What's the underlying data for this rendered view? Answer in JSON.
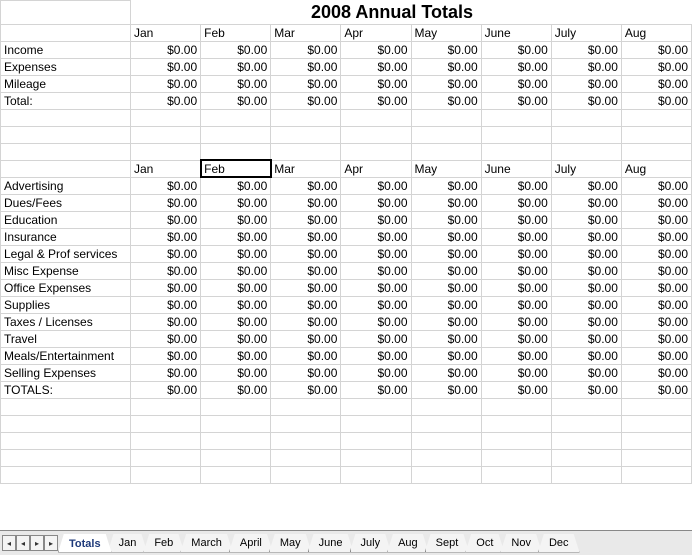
{
  "title": "2008 Annual Totals",
  "months": [
    "Jan",
    "Feb",
    "Mar",
    "Apr",
    "May",
    "June",
    "July",
    "Aug"
  ],
  "summary_rows": [
    {
      "label": "Income",
      "vals": [
        "$0.00",
        "$0.00",
        "$0.00",
        "$0.00",
        "$0.00",
        "$0.00",
        "$0.00",
        "$0.00"
      ]
    },
    {
      "label": "Expenses",
      "vals": [
        "$0.00",
        "$0.00",
        "$0.00",
        "$0.00",
        "$0.00",
        "$0.00",
        "$0.00",
        "$0.00"
      ]
    },
    {
      "label": "Mileage",
      "vals": [
        "$0.00",
        "$0.00",
        "$0.00",
        "$0.00",
        "$0.00",
        "$0.00",
        "$0.00",
        "$0.00"
      ]
    },
    {
      "label": "Total:",
      "vals": [
        "$0.00",
        "$0.00",
        "$0.00",
        "$0.00",
        "$0.00",
        "$0.00",
        "$0.00",
        "$0.00"
      ]
    }
  ],
  "detail_rows": [
    {
      "label": "Advertising",
      "vals": [
        "$0.00",
        "$0.00",
        "$0.00",
        "$0.00",
        "$0.00",
        "$0.00",
        "$0.00",
        "$0.00"
      ]
    },
    {
      "label": "Dues/Fees",
      "vals": [
        "$0.00",
        "$0.00",
        "$0.00",
        "$0.00",
        "$0.00",
        "$0.00",
        "$0.00",
        "$0.00"
      ]
    },
    {
      "label": "Education",
      "vals": [
        "$0.00",
        "$0.00",
        "$0.00",
        "$0.00",
        "$0.00",
        "$0.00",
        "$0.00",
        "$0.00"
      ]
    },
    {
      "label": "Insurance",
      "vals": [
        "$0.00",
        "$0.00",
        "$0.00",
        "$0.00",
        "$0.00",
        "$0.00",
        "$0.00",
        "$0.00"
      ]
    },
    {
      "label": "Legal & Prof services",
      "vals": [
        "$0.00",
        "$0.00",
        "$0.00",
        "$0.00",
        "$0.00",
        "$0.00",
        "$0.00",
        "$0.00"
      ]
    },
    {
      "label": "Misc Expense",
      "vals": [
        "$0.00",
        "$0.00",
        "$0.00",
        "$0.00",
        "$0.00",
        "$0.00",
        "$0.00",
        "$0.00"
      ]
    },
    {
      "label": "Office Expenses",
      "vals": [
        "$0.00",
        "$0.00",
        "$0.00",
        "$0.00",
        "$0.00",
        "$0.00",
        "$0.00",
        "$0.00"
      ]
    },
    {
      "label": "Supplies",
      "vals": [
        "$0.00",
        "$0.00",
        "$0.00",
        "$0.00",
        "$0.00",
        "$0.00",
        "$0.00",
        "$0.00"
      ]
    },
    {
      "label": "Taxes / Licenses",
      "vals": [
        "$0.00",
        "$0.00",
        "$0.00",
        "$0.00",
        "$0.00",
        "$0.00",
        "$0.00",
        "$0.00"
      ]
    },
    {
      "label": "Travel",
      "vals": [
        "$0.00",
        "$0.00",
        "$0.00",
        "$0.00",
        "$0.00",
        "$0.00",
        "$0.00",
        "$0.00"
      ]
    },
    {
      "label": "Meals/Entertainment",
      "vals": [
        "$0.00",
        "$0.00",
        "$0.00",
        "$0.00",
        "$0.00",
        "$0.00",
        "$0.00",
        "$0.00"
      ]
    },
    {
      "label": "Selling Expenses",
      "vals": [
        "$0.00",
        "$0.00",
        "$0.00",
        "$0.00",
        "$0.00",
        "$0.00",
        "$0.00",
        "$0.00"
      ]
    },
    {
      "label": "TOTALS:",
      "vals": [
        "$0.00",
        "$0.00",
        "$0.00",
        "$0.00",
        "$0.00",
        "$0.00",
        "$0.00",
        "$0.00"
      ]
    }
  ],
  "selected_cell": "Feb",
  "tabs": [
    "Totals",
    "Jan",
    "Feb",
    "March",
    "April",
    "May",
    "June",
    "July",
    "Aug",
    "Sept",
    "Oct",
    "Nov",
    "Dec"
  ],
  "active_tab": "Totals",
  "nav_glyphs": [
    "◂",
    "◂",
    "▸",
    "▸"
  ]
}
